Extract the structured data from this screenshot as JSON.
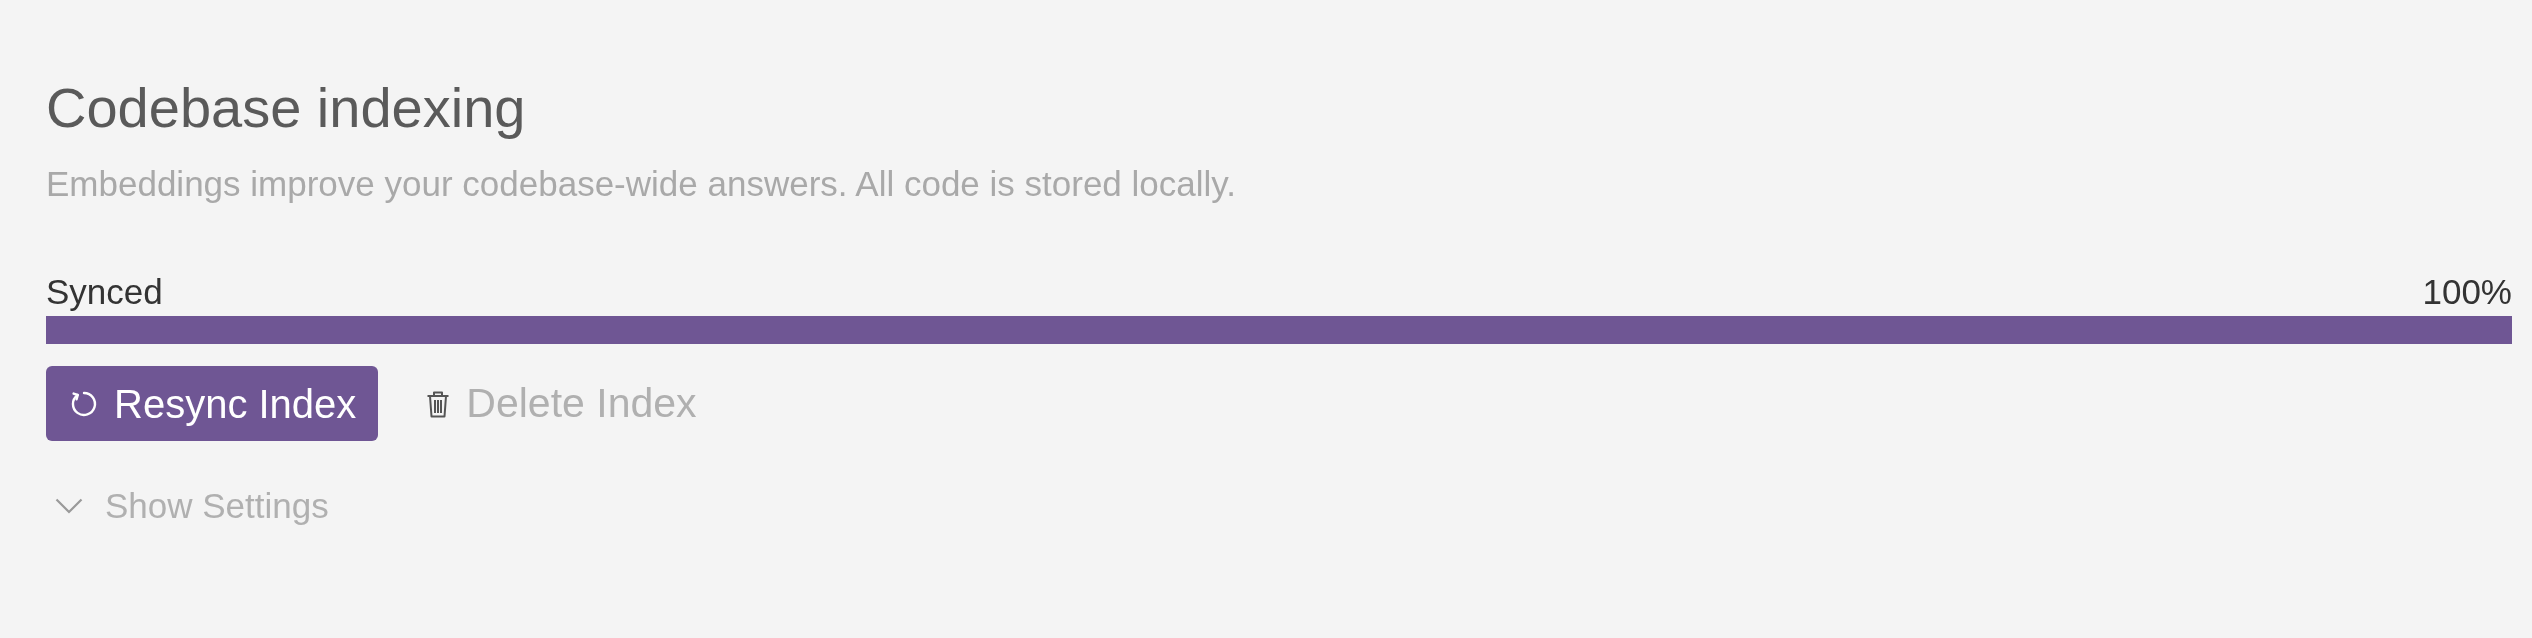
{
  "header": {
    "title": "Codebase indexing",
    "description": "Embeddings improve your codebase-wide answers. All code is stored locally."
  },
  "progress": {
    "label": "Synced",
    "reading": "100%",
    "level": 1
  },
  "buttons": [
    {
      "kind": "primary",
      "label": "Resync Index"
    },
    {
      "kind": "link",
      "label": "Delete Index"
    }
  ],
  "settings_toggle": {
    "label": "Show Settings",
    "expanded": false
  }
}
